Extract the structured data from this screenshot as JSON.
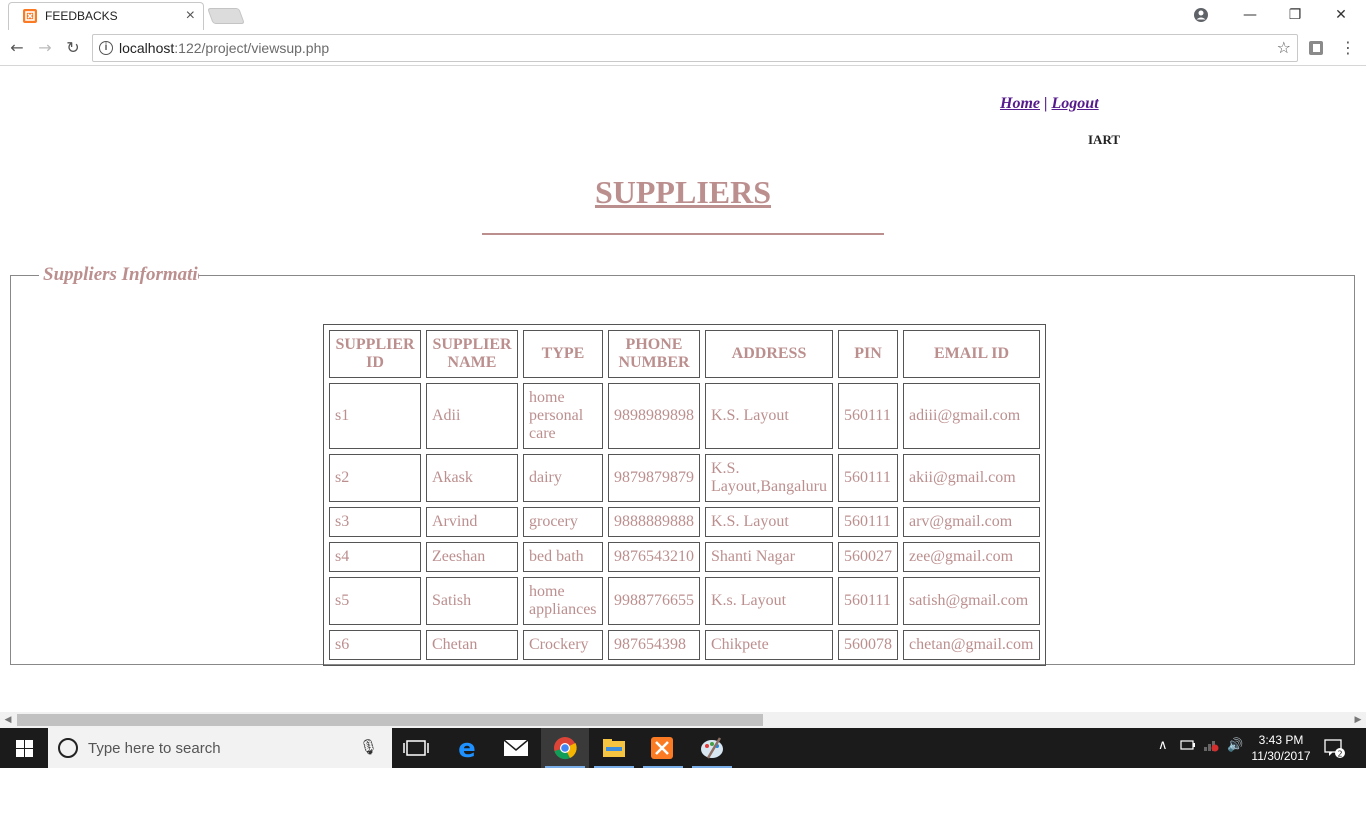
{
  "browser": {
    "tab_title": "FEEDBACKS",
    "tab_close": "×",
    "url_host": "localhost",
    "url_path": ":122/project/viewsup.php",
    "info_glyph": "i",
    "star_glyph": "☆",
    "back_glyph": "←",
    "forward_glyph": "→",
    "reload_glyph": "↻",
    "menu_glyph": "⋮",
    "minimize_glyph": "—",
    "restore_glyph": "❐",
    "close_glyph": "✕"
  },
  "nav": {
    "home_label": "Home",
    "separator": "|",
    "logout_label": "Logout"
  },
  "cart_text": "IART",
  "page_title": "SUPPLIERS",
  "fieldset_legend": "Suppliers Information",
  "table": {
    "headers": [
      "SUPPLIER ID",
      "SUPPLIER NAME",
      "TYPE",
      "PHONE NUMBER",
      "ADDRESS",
      "PIN",
      "EMAIL ID"
    ],
    "rows": [
      [
        "s1",
        "Adii",
        "home personal care",
        "9898989898",
        "K.S. Layout",
        "560111",
        "adiii@gmail.com"
      ],
      [
        "s2",
        "Akask",
        "dairy",
        "9879879879",
        "K.S. Layout,Bangaluru",
        "560111",
        "akii@gmail.com"
      ],
      [
        "s3",
        "Arvind",
        "grocery",
        "9888889888",
        "K.S. Layout",
        "560111",
        "arv@gmail.com"
      ],
      [
        "s4",
        "Zeeshan",
        "bed bath",
        "9876543210",
        "Shanti Nagar",
        "560027",
        "zee@gmail.com"
      ],
      [
        "s5",
        "Satish",
        "home appliances",
        "9988776655",
        "K.s. Layout",
        "560111",
        "satish@gmail.com"
      ],
      [
        "s6",
        "Chetan",
        "Crockery",
        "987654398",
        "Chikpete",
        "560078",
        "chetan@gmail.com"
      ]
    ]
  },
  "taskbar": {
    "search_placeholder": "Type here to search",
    "time": "3:43 PM",
    "date": "11/30/2017",
    "notification_count": "2"
  },
  "colors": {
    "accent": "#bc8f8f",
    "link": "#551a8b",
    "taskbar": "#1b1b1b"
  }
}
